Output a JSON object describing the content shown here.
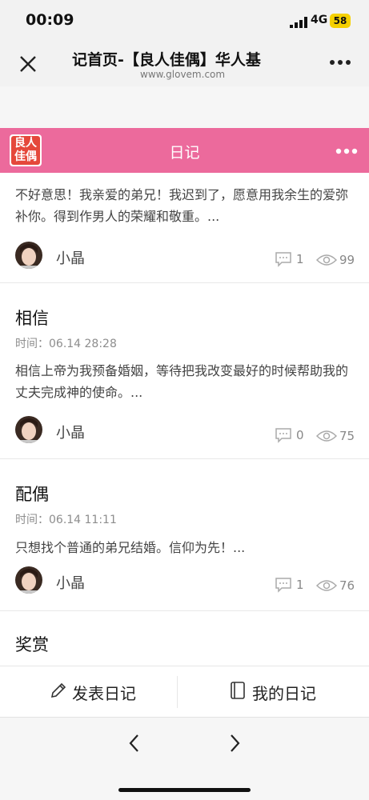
{
  "status_bar": {
    "time": "00:09",
    "network": "4G",
    "battery": "58"
  },
  "browser": {
    "title": "记首页-【良人佳偶】华人基",
    "url": "www.glovem.com"
  },
  "header": {
    "logo_text_line1": "良人",
    "logo_text_line2": "佳偶",
    "title": "日记"
  },
  "entries": [
    {
      "title": "",
      "time": "",
      "excerpt": "不好意思！我亲爱的弟兄！我迟到了，愿意用我余生的爱弥补你。得到作男人的荣耀和敬重。...",
      "author": "小晶",
      "comments": "1",
      "views": "99"
    },
    {
      "title": "相信",
      "time": "时间：06.14 28:28",
      "excerpt": "相信上帝为我预备婚姻，等待把我改变最好的时候帮助我的丈夫完成神的使命。...",
      "author": "小晶",
      "comments": "0",
      "views": "75"
    },
    {
      "title": "配偶",
      "time": "时间：06.14 11:11",
      "excerpt": "只想找个普通的弟兄结婚。信仰为先！...",
      "author": "小晶",
      "comments": "1",
      "views": "76"
    },
    {
      "title": "奖赏",
      "time": "",
      "excerpt": "",
      "author": "",
      "comments": "",
      "views": ""
    }
  ],
  "actions": {
    "publish": "发表日记",
    "my_diary": "我的日记"
  },
  "colors": {
    "header_pink": "#ec6a9c",
    "logo_red": "#e5483b"
  }
}
